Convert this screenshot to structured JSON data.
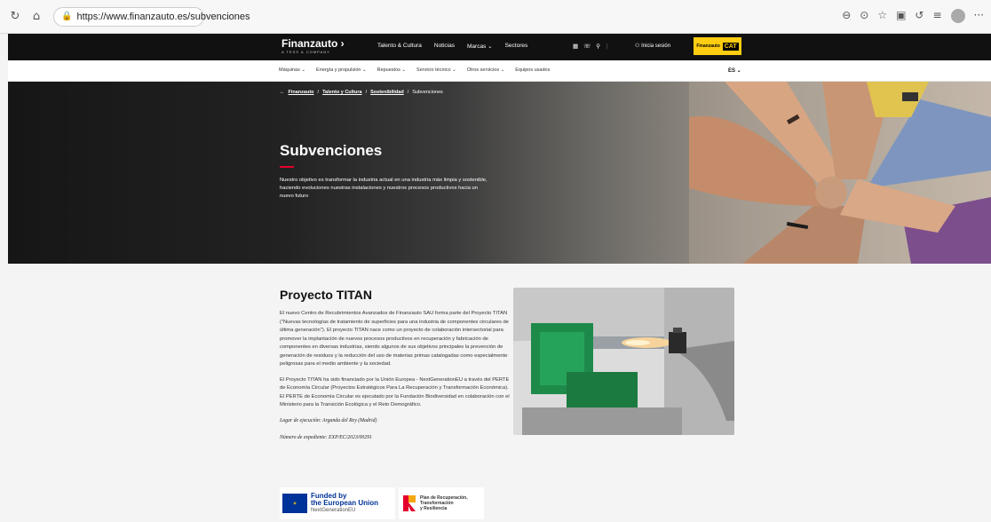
{
  "browser": {
    "url": "https://www.finanzauto.es/subvenciones"
  },
  "header": {
    "logo_text": "Finanzauto",
    "logo_sub": "A TESS & COMPANY",
    "nav": [
      "Talento & Cultura",
      "Noticias",
      "Marcas",
      "Sectores"
    ],
    "login_label": "Inicia sesión",
    "cat_brand": "Finanzauto",
    "cat_label": "CAT"
  },
  "subnav": {
    "items": [
      "Máquinas",
      "Energía y propulsión",
      "Repuestos",
      "Servicio técnico",
      "Otros servicios",
      "Equipos usados"
    ],
    "language": "ES"
  },
  "hero": {
    "breadcrumb": [
      "Finanzauto",
      "Talento y Cultura",
      "Sostenibilidad",
      "Subvenciones"
    ],
    "title": "Subvenciones",
    "description": "Nuestro objetivo es transformar la industria actual en una industria más limpia y sostenible, haciendo evoluciones nuestras instalaciones y nuestros procesos productivos hacia un nuevo futuro"
  },
  "project": {
    "title": "Proyecto TITAN",
    "paragraph1": "El nuevo Centro de Recubrimientos Avanzados de Finanzauto SAU forma parte del Proyecto TITAN (\"Nuevas tecnologías de tratamiento de superficies para una industria de componentes circulares de última generación\"). El proyecto TITAN nace como un proyecto de colaboración intersectorial para promover la implantación de nuevos procesos productivos en recuperación y fabricación de componentes en diversas industrias, siendo algunos de sus objetivos principales la prevención de generación de residuos y la reducción del uso de materias primas catalogadas como especialmente peligrosas para el medio ambiente y la sociedad.",
    "paragraph2": "El Proyecto TITAN ha sido financiado por la Unión Europea - NextGenerationEU a través del PERTE de Economía Circular (Proyectos Estratégicos Para La Recuperación y Transformación Económica). El PERTE de Economía Circular es ejecutado por la Fundación Biodiversidad en colaboración con el Ministerio para la Transición Ecológica y el Reto Demográfico.",
    "location": "Lugar de ejecución: Arganda del Rey (Madrid)",
    "file_number": "Número de expediente: EXP/EC/2023/00291",
    "eu_funded_by": "Funded by",
    "eu_union": "the European Union",
    "eu_nextgen": "NextGenerationEU",
    "prtr_line1": "Plan de Recuperación,",
    "prtr_line2": "Transformación",
    "prtr_line3": "y Resiliencia"
  },
  "colors": {
    "accent_red": "#e4002b",
    "cat_yellow": "#ffcd11",
    "header_black": "#111111"
  }
}
